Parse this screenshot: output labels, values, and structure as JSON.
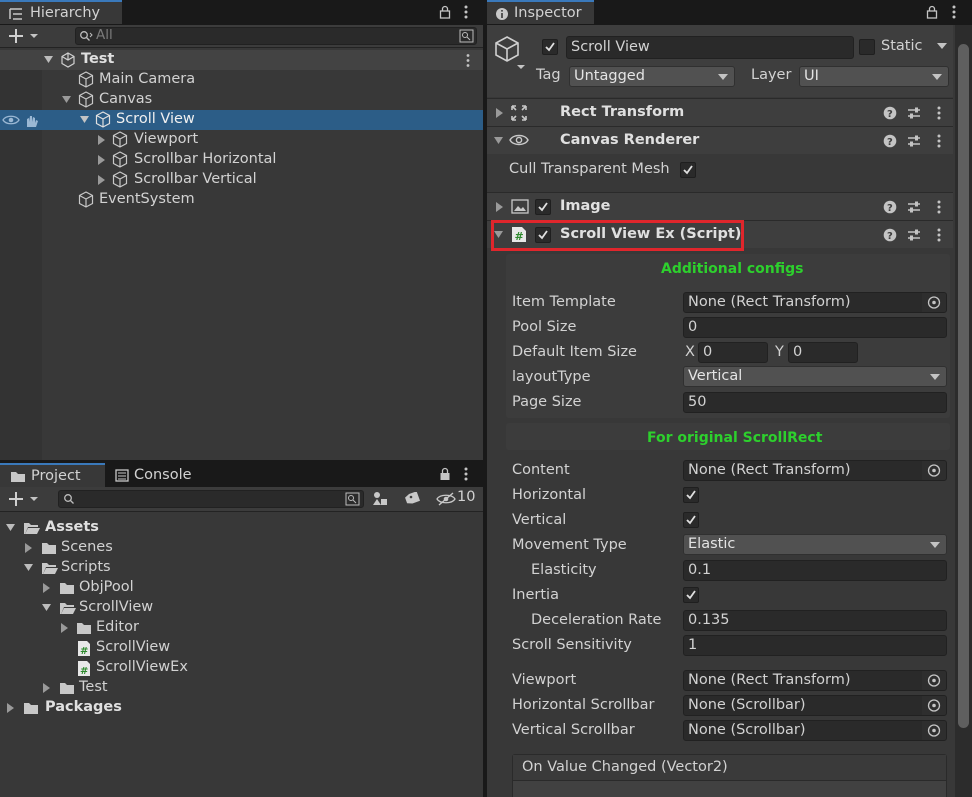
{
  "hierarchy": {
    "tab_label": "Hierarchy",
    "search_placeholder": "All",
    "items": [
      {
        "label": "Test",
        "icon": "unity-scene-icon"
      },
      {
        "label": "Main Camera",
        "icon": "gameobject-cube-icon"
      },
      {
        "label": "Canvas",
        "icon": "gameobject-cube-icon"
      },
      {
        "label": "Scroll View",
        "icon": "gameobject-cube-icon"
      },
      {
        "label": "Viewport",
        "icon": "gameobject-cube-icon"
      },
      {
        "label": "Scrollbar Horizontal",
        "icon": "gameobject-cube-icon"
      },
      {
        "label": "Scrollbar Vertical",
        "icon": "gameobject-cube-icon"
      },
      {
        "label": "EventSystem",
        "icon": "gameobject-cube-icon"
      }
    ]
  },
  "project": {
    "tabs": [
      {
        "label": "Project"
      },
      {
        "label": "Console"
      }
    ],
    "hidden_count": "10",
    "tree": [
      {
        "label": "Assets"
      },
      {
        "label": "Scenes"
      },
      {
        "label": "Scripts"
      },
      {
        "label": "ObjPool"
      },
      {
        "label": "ScrollView"
      },
      {
        "label": "Editor"
      },
      {
        "label": "ScrollView"
      },
      {
        "label": "ScrollViewEx"
      },
      {
        "label": "Test"
      },
      {
        "label": "Packages"
      }
    ]
  },
  "inspector": {
    "tab_label": "Inspector",
    "object_name": "Scroll View",
    "static_label": "Static",
    "tag_label": "Tag",
    "tag_value": "Untagged",
    "layer_label": "Layer",
    "layer_value": "UI",
    "components": [
      {
        "label": "Rect Transform"
      },
      {
        "label": "Canvas Renderer"
      },
      {
        "label": "Image"
      },
      {
        "label": "Scroll View Ex (Script)"
      }
    ],
    "cull_label": "Cull Transparent Mesh",
    "section1_title": "Additional configs",
    "item_template_label": "Item Template",
    "item_template_value": "None (Rect Transform)",
    "pool_size_label": "Pool Size",
    "pool_size_value": "0",
    "default_item_size_label": "Default Item Size",
    "x_label": "X",
    "x_value": "0",
    "y_label": "Y",
    "y_value": "0",
    "layout_type_label": "layoutType",
    "layout_type_value": "Vertical",
    "page_size_label": "Page Size",
    "page_size_value": "50",
    "section2_title": "For original ScrollRect",
    "content_label": "Content",
    "content_value": "None (Rect Transform)",
    "horizontal_label": "Horizontal",
    "vertical_label": "Vertical",
    "movement_type_label": "Movement Type",
    "movement_type_value": "Elastic",
    "elasticity_label": "Elasticity",
    "elasticity_value": "0.1",
    "inertia_label": "Inertia",
    "deceleration_label": "Deceleration Rate",
    "deceleration_value": "0.135",
    "scroll_sensitivity_label": "Scroll Sensitivity",
    "scroll_sensitivity_value": "1",
    "viewport_label": "Viewport",
    "viewport_value": "None (Rect Transform)",
    "hscrollbar_label": "Horizontal Scrollbar",
    "hscrollbar_value": "None (Scrollbar)",
    "vscrollbar_label": "Vertical Scrollbar",
    "vscrollbar_value": "None (Scrollbar)",
    "on_value_changed_label": "On Value Changed (Vector2)"
  },
  "colors": {
    "selection": "#2c5d87",
    "highlight_box": "#e0262c",
    "section_title": "#2dd02d",
    "tab_accent": "#3a79bb"
  }
}
